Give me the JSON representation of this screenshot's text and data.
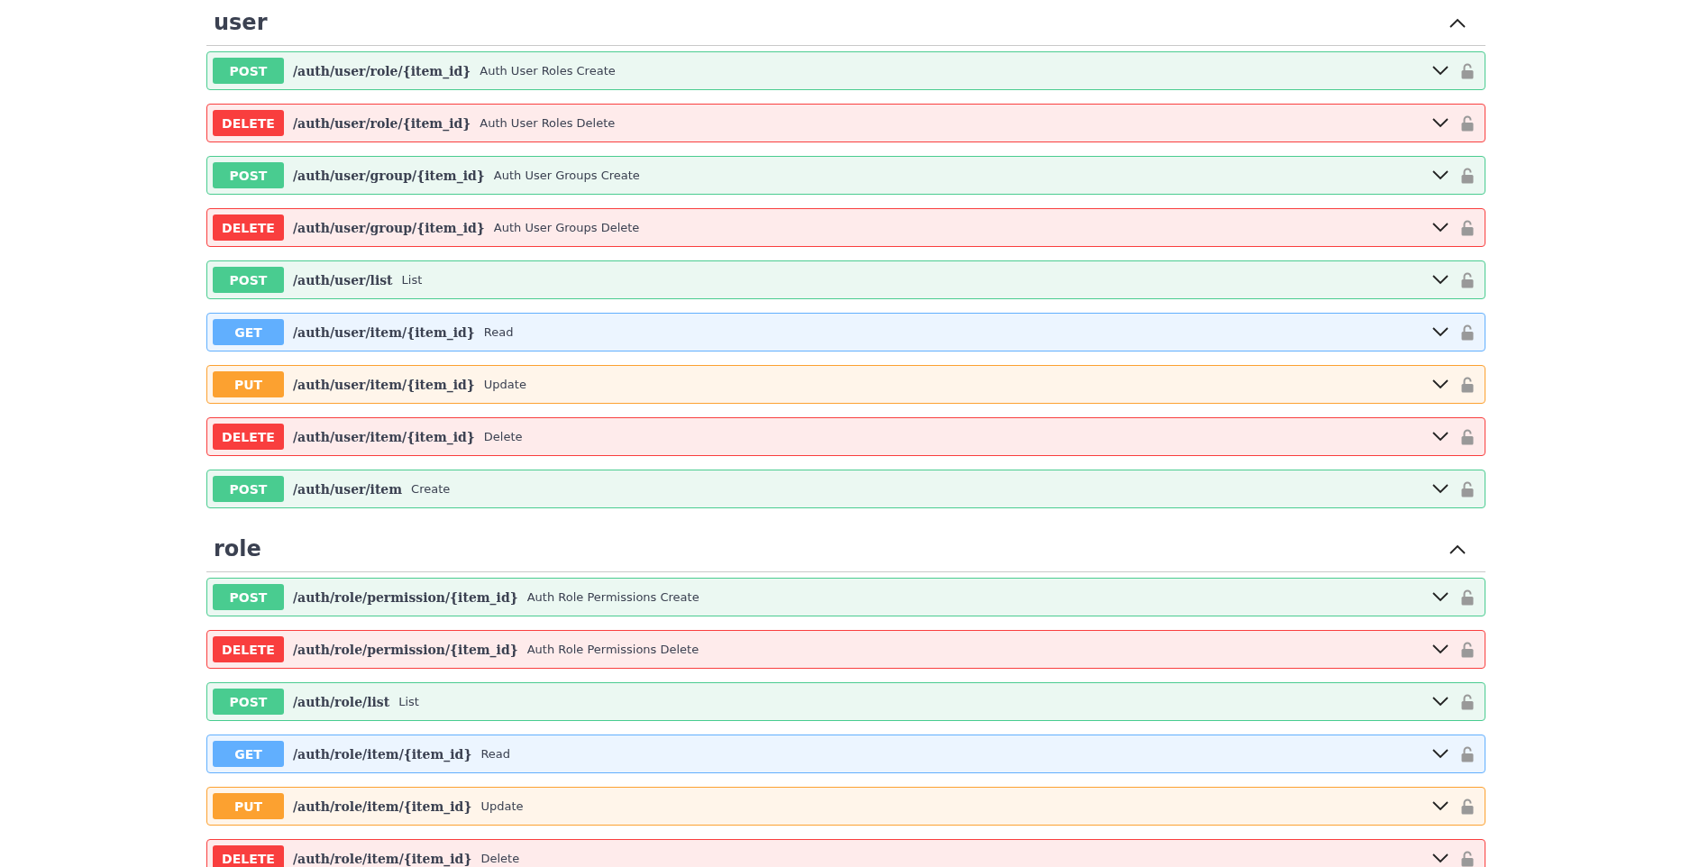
{
  "sections": [
    {
      "title": "user",
      "expanded": true,
      "operations": [
        {
          "kind": "post",
          "method": "POST",
          "path": "/auth/user/role/{item_id}",
          "summary": "Auth User Roles Create",
          "expanded": false
        },
        {
          "kind": "delete",
          "method": "DELETE",
          "path": "/auth/user/role/{item_id}",
          "summary": "Auth User Roles Delete",
          "expanded": false
        },
        {
          "kind": "post",
          "method": "POST",
          "path": "/auth/user/group/{item_id}",
          "summary": "Auth User Groups Create",
          "expanded": false
        },
        {
          "kind": "delete",
          "method": "DELETE",
          "path": "/auth/user/group/{item_id}",
          "summary": "Auth User Groups Delete",
          "expanded": false
        },
        {
          "kind": "post",
          "method": "POST",
          "path": "/auth/user/list",
          "summary": "List",
          "expanded": false
        },
        {
          "kind": "get",
          "method": "GET",
          "path": "/auth/user/item/{item_id}",
          "summary": "Read",
          "expanded": false
        },
        {
          "kind": "put",
          "method": "PUT",
          "path": "/auth/user/item/{item_id}",
          "summary": "Update",
          "expanded": false
        },
        {
          "kind": "delete",
          "method": "DELETE",
          "path": "/auth/user/item/{item_id}",
          "summary": "Delete",
          "expanded": false
        },
        {
          "kind": "post",
          "method": "POST",
          "path": "/auth/user/item",
          "summary": "Create",
          "expanded": false
        }
      ]
    },
    {
      "title": "role",
      "expanded": true,
      "operations": [
        {
          "kind": "post",
          "method": "POST",
          "path": "/auth/role/permission/{item_id}",
          "summary": "Auth Role Permissions Create",
          "expanded": false
        },
        {
          "kind": "delete",
          "method": "DELETE",
          "path": "/auth/role/permission/{item_id}",
          "summary": "Auth Role Permissions Delete",
          "expanded": false
        },
        {
          "kind": "post",
          "method": "POST",
          "path": "/auth/role/list",
          "summary": "List",
          "expanded": false
        },
        {
          "kind": "get",
          "method": "GET",
          "path": "/auth/role/item/{item_id}",
          "summary": "Read",
          "expanded": false
        },
        {
          "kind": "put",
          "method": "PUT",
          "path": "/auth/role/item/{item_id}",
          "summary": "Update",
          "expanded": false
        },
        {
          "kind": "delete",
          "method": "DELETE",
          "path": "/auth/role/item/{item_id}",
          "summary": "Delete",
          "expanded": false
        }
      ]
    }
  ]
}
